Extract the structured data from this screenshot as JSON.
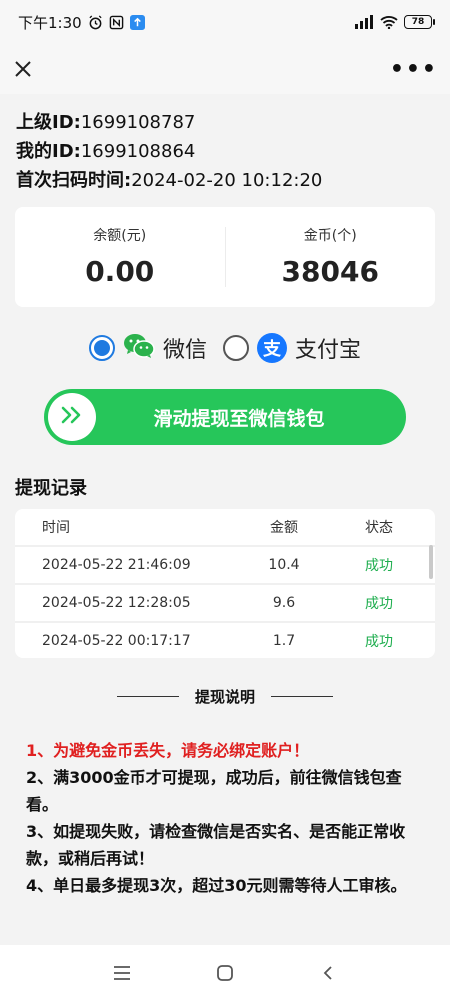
{
  "status_bar": {
    "time": "下午1:30",
    "battery": "78"
  },
  "navbar": {
    "close_icon": "close-icon",
    "more_icon": "more-icon",
    "more_glyph": "•••"
  },
  "info": {
    "parent_id_label": "上级ID:",
    "parent_id_value": "1699108787",
    "my_id_label": "我的ID:",
    "my_id_value": "1699108864",
    "first_scan_label": "首次扫码时间:",
    "first_scan_value": "2024-02-20 10:12:20"
  },
  "balance": {
    "balance_label": "余额(元)",
    "balance_value": "0.00",
    "coins_label": "金币(个)",
    "coins_value": "38046"
  },
  "payment": {
    "wechat_label": "微信",
    "alipay_label": "支付宝",
    "alipay_glyph": "支",
    "selected": "wechat"
  },
  "slide": {
    "label": "滑动提现至微信钱包"
  },
  "records": {
    "title": "提现记录",
    "headers": {
      "time": "时间",
      "amount": "金额",
      "status": "状态"
    },
    "rows": [
      {
        "time": "2024-05-22 21:46:09",
        "amount": "10.4",
        "status": "成功"
      },
      {
        "time": "2024-05-22 12:28:05",
        "amount": "9.6",
        "status": "成功"
      },
      {
        "time": "2024-05-22 00:17:17",
        "amount": "1.7",
        "status": "成功"
      }
    ]
  },
  "explain": {
    "title": "提现说明",
    "rule1": "1、为避免金币丢失，请务必绑定账户！",
    "rule2": "2、满3000金币才可提现，成功后，前往微信钱包查看。",
    "rule3": "3、如提现失败，请检查微信是否实名、是否能正常收款，或稍后再试！",
    "rule4": "4、单日最多提现3次，超过30元则需等待人工审核。"
  },
  "colors": {
    "accent_green": "#26c65a",
    "radio_blue": "#1f7ae0",
    "warning_red": "#e02020",
    "success_green": "#1fae4f"
  }
}
